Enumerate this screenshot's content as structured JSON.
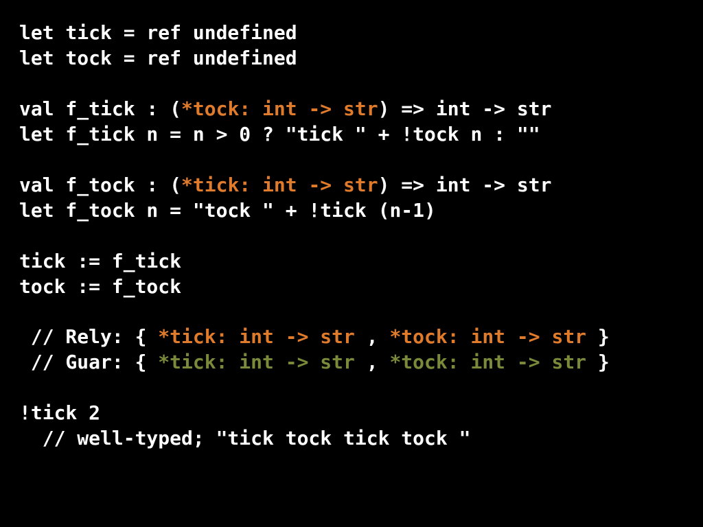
{
  "code": {
    "l1": "let tick = ref undefined",
    "l2": "let tock = ref undefined",
    "l3_a": "val f_tick : (",
    "l3_b": "*tock: int -> str",
    "l3_c": ") => int -> str",
    "l4": "let f_tick n = n > 0 ? \"tick \" + !tock n : \"\"",
    "l5_a": "val f_tock : (",
    "l5_b": "*tick: int -> str",
    "l5_c": ") => int -> str",
    "l6": "let f_tock n = \"tock \" + !tick (n-1)",
    "l7": "tick := f_tick",
    "l8": "tock := f_tock",
    "l9_a": " // Rely: { ",
    "l9_b": "*tick: int -> str",
    "l9_c": " , ",
    "l9_d": "*tock: int -> str",
    "l9_e": " }",
    "l10_a": " // Guar: { ",
    "l10_b": "*tick: int -> str",
    "l10_c": " , ",
    "l10_d": "*tock: int -> str",
    "l10_e": " }",
    "l11": "!tick 2",
    "l12": "  // well-typed; \"tick tock tick tock \""
  }
}
